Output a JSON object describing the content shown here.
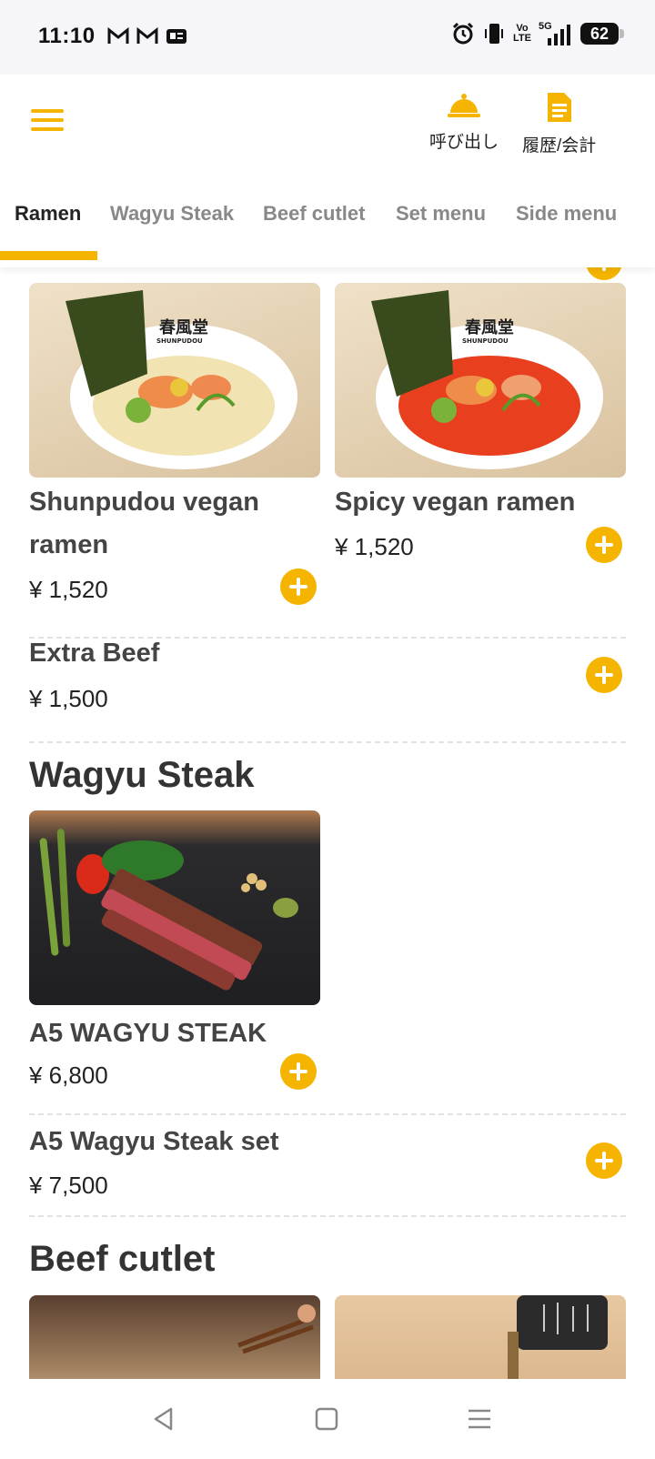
{
  "status_bar": {
    "time": "11:10",
    "network_top": "5G",
    "volte_top": "Vo",
    "volte_bottom": "LTE",
    "battery": "62"
  },
  "header": {
    "call_label": "呼び出し",
    "history_label": "履歴/会計"
  },
  "tabs": [
    {
      "label": "Ramen",
      "active": true
    },
    {
      "label": "Wagyu Steak"
    },
    {
      "label": "Beef cutlet"
    },
    {
      "label": "Set menu"
    },
    {
      "label": "Side menu"
    }
  ],
  "ramen": {
    "items": [
      {
        "name_line1": "Shunpudou vegan",
        "name_line2": "ramen",
        "price": "¥ 1,520"
      },
      {
        "name": "Spicy vegan ramen",
        "price": "¥ 1,520"
      }
    ],
    "extra": {
      "name": "Extra Beef",
      "price": "¥ 1,500"
    }
  },
  "wagyu": {
    "title": "Wagyu Steak",
    "item": {
      "name": "A5 WAGYU STEAK",
      "price": "¥ 6,800"
    },
    "set": {
      "name": "A5 Wagyu Steak set",
      "price": "¥ 7,500"
    }
  },
  "beef_cutlet": {
    "title": "Beef cutlet"
  },
  "bowl_brand": {
    "kanji": "春風堂",
    "latin": "SHUNPUDOU"
  },
  "colors": {
    "accent": "#f5b400",
    "broth": "#f1e3b2",
    "spicy_broth": "#e8401f"
  },
  "icons": [
    "menu-icon",
    "bell-icon",
    "receipt-icon",
    "plus-icon",
    "back-icon",
    "home-icon",
    "recents-icon"
  ]
}
